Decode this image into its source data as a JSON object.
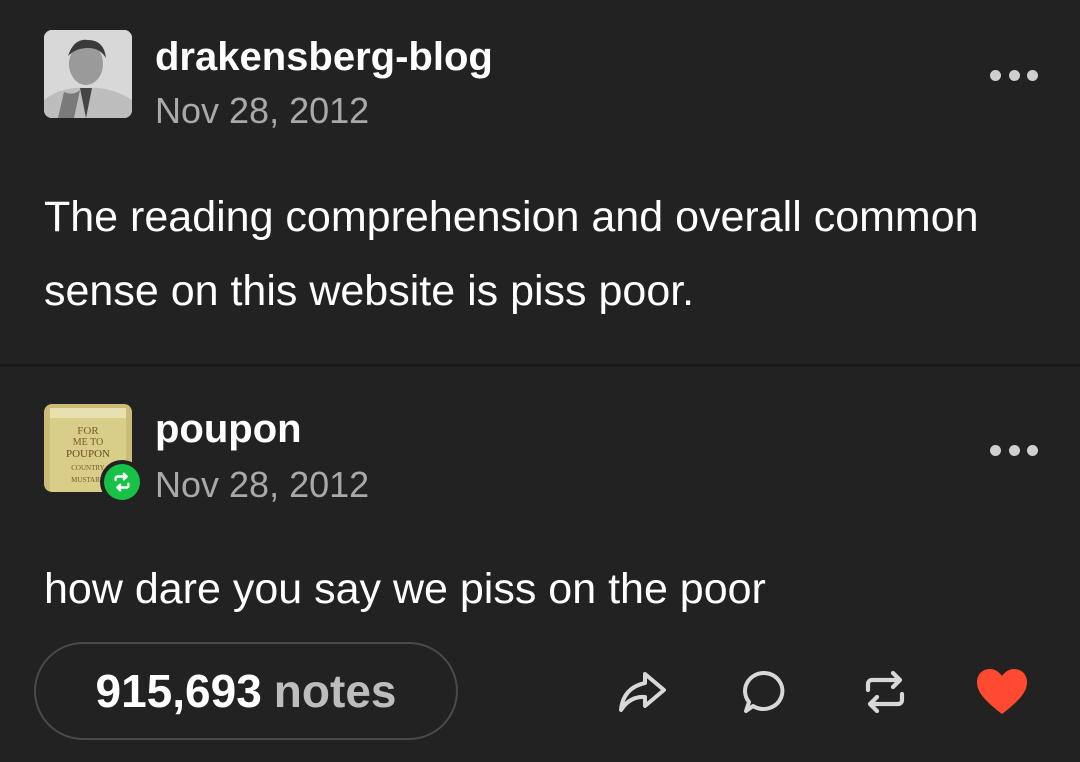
{
  "posts": [
    {
      "username": "drakensberg-blog",
      "date": "Nov 28, 2012",
      "body": "The reading comprehension and overall common sense on this website is piss poor."
    },
    {
      "username": "poupon",
      "date": "Nov 28, 2012",
      "body": "how dare you say we piss on the poor",
      "avatar_text": [
        "FOR",
        "ME TO",
        "POUPON",
        "COUNTRY",
        "MUSTARD"
      ]
    }
  ],
  "footer": {
    "notes_count": "915,693",
    "notes_label": "notes",
    "icons": [
      "share-icon",
      "reply-icon",
      "reblog-icon",
      "like-icon"
    ],
    "like_color": "#ff4930"
  },
  "colors": {
    "background": "#222222",
    "secondary_text": "#a9a9a9",
    "reblog_green": "#17c246"
  }
}
